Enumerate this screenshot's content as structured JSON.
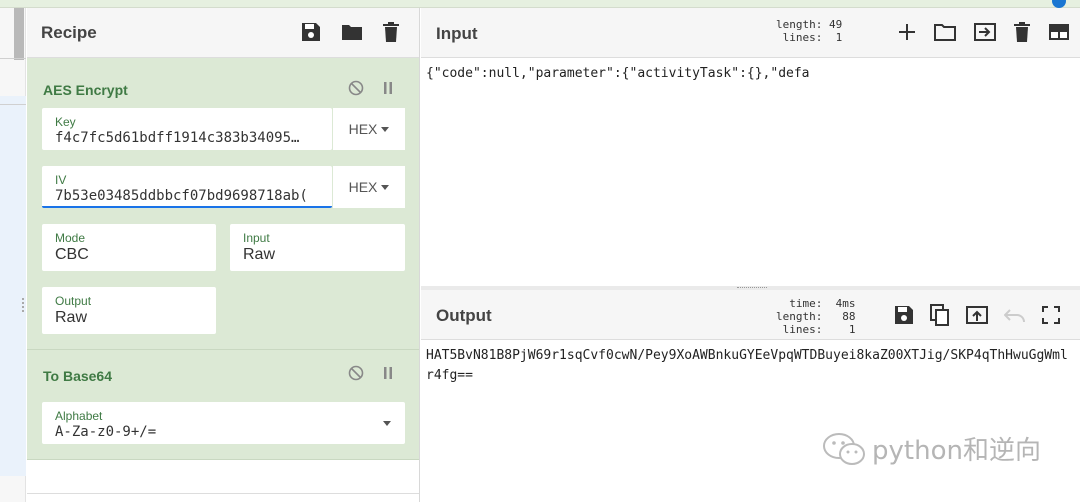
{
  "recipe": {
    "title": "Recipe",
    "icons": [
      "save-icon",
      "folder-icon",
      "trash-icon"
    ],
    "operations": [
      {
        "name": "AES Encrypt",
        "fields": {
          "key": {
            "label": "Key",
            "value": "f4c7fc5d61bdff1914c383b34095…",
            "format": "HEX"
          },
          "iv": {
            "label": "IV",
            "value": "7b53e03485ddbbcf07bd9698718ab(",
            "format": "HEX"
          },
          "mode": {
            "label": "Mode",
            "value": "CBC"
          },
          "input": {
            "label": "Input",
            "value": "Raw"
          },
          "output": {
            "label": "Output",
            "value": "Raw"
          }
        }
      },
      {
        "name": "To Base64",
        "fields": {
          "alphabet": {
            "label": "Alphabet",
            "value": "A-Za-z0-9+/="
          }
        }
      }
    ]
  },
  "input": {
    "title": "Input",
    "stats": "length: 49\n lines:  1",
    "text": "{\"code\":null,\"parameter\":{\"activityTask\":{},\"defa"
  },
  "output": {
    "title": "Output",
    "stats": "  time:  4ms\nlength:   88\n lines:    1",
    "text": "HAT5BvN81B8PjW69r1sqCvf0cwN/Pey9XoAWBnkuGYEeVpqWTDBuyei8kaZ00XTJig/SKP4qThHwuGgWmlr4fg=="
  },
  "watermark": "python和逆向",
  "colors": {
    "op_bg": "#dce9d5",
    "op_title": "#3f7a44",
    "accent": "#1a73e8"
  }
}
